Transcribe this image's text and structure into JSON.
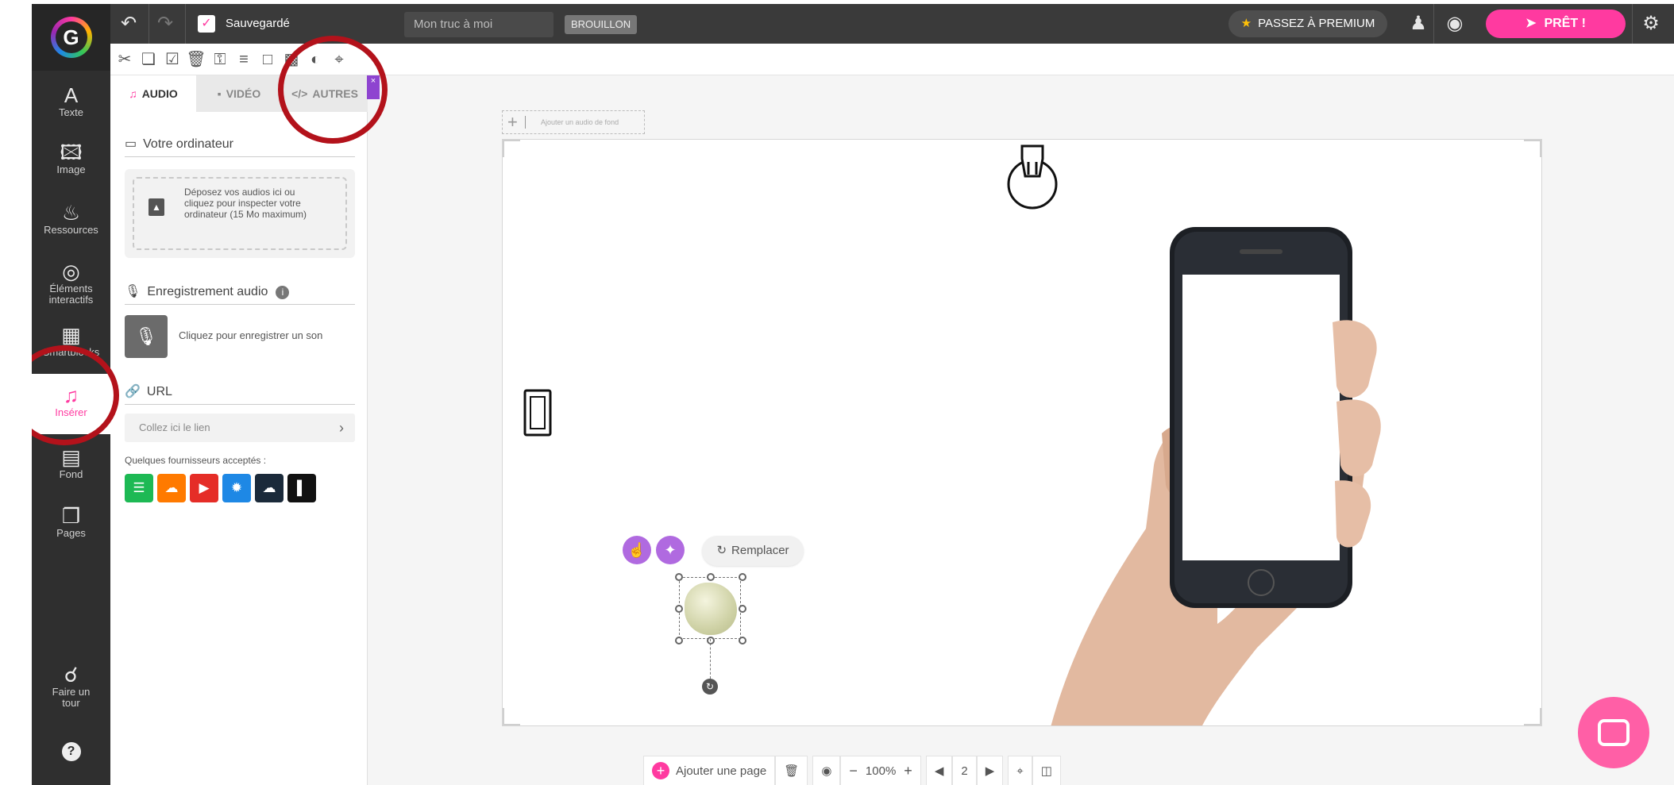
{
  "topbar": {
    "saved_label": "Sauvegardé",
    "doc_title": "Mon truc à moi",
    "draft_badge": "BROUILLON",
    "premium_label": "PASSEZ À PREMIUM",
    "ready_label": "PRÊT !"
  },
  "rail": {
    "text": "Texte",
    "image": "Image",
    "resources": "Ressources",
    "interactive_1": "Éléments",
    "interactive_2": "interactifs",
    "smartblocks": "Smartblocks",
    "insert": "Insérer",
    "background": "Fond",
    "pages": "Pages",
    "tour_1": "Faire un",
    "tour_2": "tour"
  },
  "panel": {
    "tabs": {
      "audio": "AUDIO",
      "video": "VIDÉO",
      "others": "AUTRES"
    },
    "computer_title": "Votre ordinateur",
    "dropzone_text": "Déposez vos audios ici ou cliquez pour inspecter votre ordinateur (15 Mo maximum)",
    "recording_title": "Enregistrement audio",
    "record_label": "Cliquez pour enregistrer un son",
    "url_title": "URL",
    "url_placeholder": "Collez ici le lien",
    "providers_label": "Quelques fournisseurs acceptés :",
    "providers": [
      "spotify",
      "soundcloud",
      "youtube",
      "deezer",
      "cloud",
      "audio-wave"
    ]
  },
  "canvas": {
    "bg_audio_label": "Ajouter un audio de fond",
    "replace_label": "Remplacer"
  },
  "bottombar": {
    "add_page_label": "Ajouter une page",
    "zoom": "100%",
    "page_number": "2"
  },
  "colors": {
    "accent": "#ff3aa0",
    "purple": "#b06ae0",
    "annotation_red": "#b3121b",
    "dark_bar": "#3a3a3a"
  }
}
